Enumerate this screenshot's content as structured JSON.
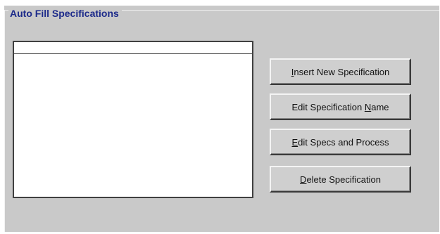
{
  "group": {
    "title": "Auto Fill Specifications"
  },
  "specifications_list": {
    "items": []
  },
  "buttons": {
    "insert": {
      "pre": "",
      "mnemonic": "I",
      "post": "nsert New Specification"
    },
    "edit_name": {
      "pre": "Edit Specification ",
      "mnemonic": "N",
      "post": "ame"
    },
    "edit_specs": {
      "pre": "",
      "mnemonic": "E",
      "post": "dit Specs and Process"
    },
    "delete": {
      "pre": "",
      "mnemonic": "D",
      "post": "elete Specification"
    }
  },
  "colors": {
    "panel_bg": "#c9c9c9",
    "title_text": "#1c2a8a"
  }
}
